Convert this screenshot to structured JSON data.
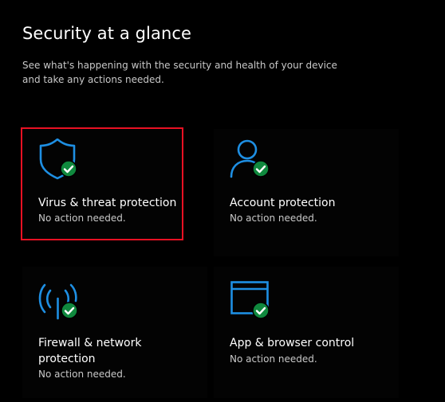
{
  "header": {
    "title": "Security at a glance",
    "subtitle": "See what's happening with the security and health of your device and take any actions needed."
  },
  "colors": {
    "accent": "#1e8fe3",
    "ok": "#10893e",
    "selection": "#e81123"
  },
  "tiles": [
    {
      "title": "Virus & threat protection",
      "status": "No action needed.",
      "icon": "shield-icon",
      "badge": "checkmark-badge-icon",
      "selected": true
    },
    {
      "title": "Account protection",
      "status": "No action needed.",
      "icon": "person-icon",
      "badge": "checkmark-badge-icon",
      "selected": false
    },
    {
      "title": "Firewall & network protection",
      "status": "No action needed.",
      "icon": "wifi-antenna-icon",
      "badge": "checkmark-badge-icon",
      "selected": false
    },
    {
      "title": "App & browser control",
      "status": "No action needed.",
      "icon": "app-window-icon",
      "badge": "checkmark-badge-icon",
      "selected": false
    }
  ]
}
